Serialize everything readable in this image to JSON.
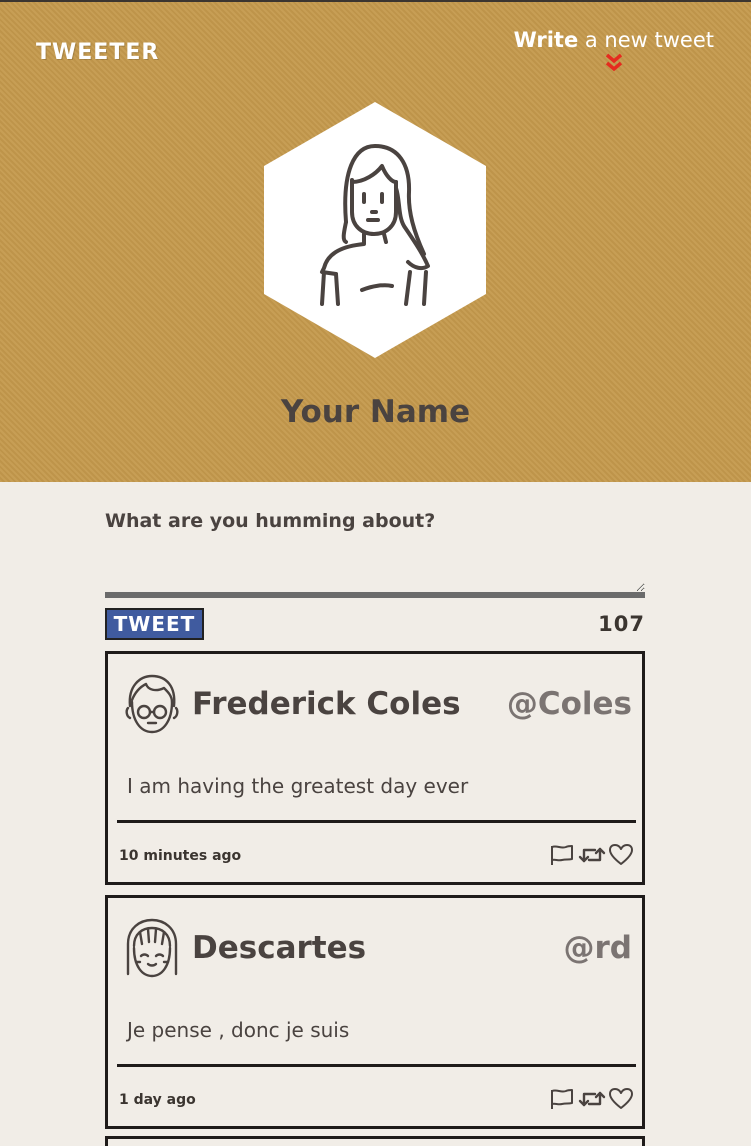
{
  "header": {
    "brand": "TWEETER",
    "compose_bold": "Write",
    "compose_rest": " a new tweet"
  },
  "profile": {
    "name": "Your Name"
  },
  "composer": {
    "label": "What are you humming about?",
    "value": "",
    "placeholder": "",
    "button_label": "TWEET",
    "char_count": "107"
  },
  "tweets": [
    {
      "name": "Frederick Coles",
      "handle": "@Coles",
      "text": "I am having the greatest day ever",
      "time": "10 minutes ago"
    },
    {
      "name": "Descartes",
      "handle": "@rd",
      "text": "Je pense , donc je suis",
      "time": "1 day ago"
    }
  ],
  "colors": {
    "hero_bg": "#c4994c",
    "page_bg": "#f1ede7",
    "accent_red": "#e52b1f",
    "button_blue": "#405b9f"
  },
  "icons": [
    "chevron-double-down-icon",
    "flag-icon",
    "retweet-icon",
    "heart-icon"
  ]
}
